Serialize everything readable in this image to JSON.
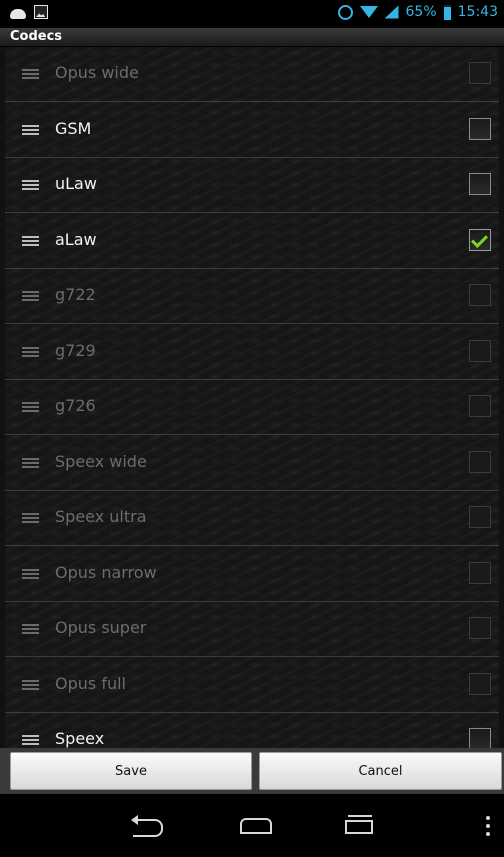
{
  "status_bar": {
    "left_icons": [
      "cloud-upload-icon",
      "image-icon"
    ],
    "right_icons": [
      "alarm-icon",
      "wifi-icon",
      "signal-icon",
      "battery-icon"
    ],
    "battery_percent": "65%",
    "time": "15:43",
    "accent_color": "#33b5e5"
  },
  "title": "Codecs",
  "codecs": [
    {
      "name": "Opus wide",
      "enabled": false,
      "checked": false
    },
    {
      "name": "GSM",
      "enabled": true,
      "checked": false
    },
    {
      "name": "uLaw",
      "enabled": true,
      "checked": false
    },
    {
      "name": "aLaw",
      "enabled": true,
      "checked": true
    },
    {
      "name": "g722",
      "enabled": false,
      "checked": false
    },
    {
      "name": "g729",
      "enabled": false,
      "checked": false
    },
    {
      "name": "g726",
      "enabled": false,
      "checked": false
    },
    {
      "name": "Speex wide",
      "enabled": false,
      "checked": false
    },
    {
      "name": "Speex ultra",
      "enabled": false,
      "checked": false
    },
    {
      "name": "Opus narrow",
      "enabled": false,
      "checked": false
    },
    {
      "name": "Opus super",
      "enabled": false,
      "checked": false
    },
    {
      "name": "Opus full",
      "enabled": false,
      "checked": false
    },
    {
      "name": "Speex",
      "enabled": true,
      "checked": false
    }
  ],
  "buttons": {
    "save_label": "Save",
    "cancel_label": "Cancel"
  },
  "nav_bar": {
    "icons": [
      "back-icon",
      "home-icon",
      "recent-apps-icon",
      "overflow-menu-icon"
    ]
  },
  "colors": {
    "check_color": "#7fd321",
    "enabled_text": "#f2f2f2",
    "disabled_text": "#6c6c6c"
  }
}
